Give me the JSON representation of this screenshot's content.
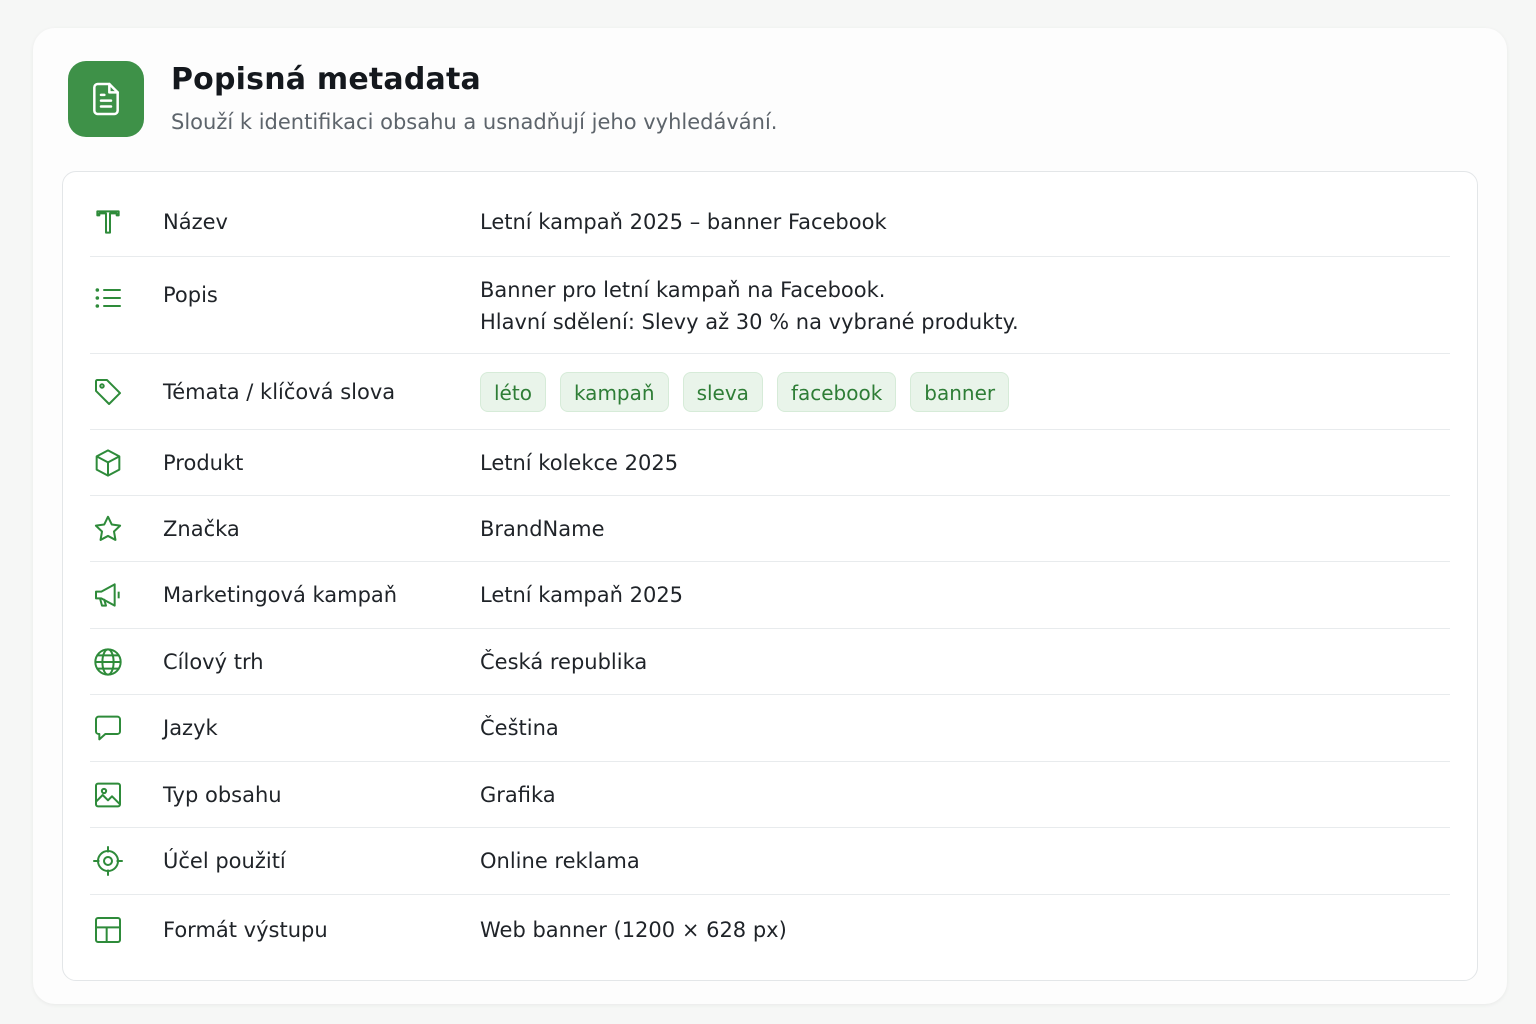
{
  "header": {
    "title": "Popisná metadata",
    "subtitle": "Slouží k identifikaci obsahu a usnadňují jeho vyhledávání.",
    "icon": "document-icon",
    "accent_color": "#3e9148"
  },
  "rows": {
    "name": {
      "icon": "text-icon",
      "label": "Název",
      "value": "Letní kampaň 2025 – banner Facebook"
    },
    "description": {
      "icon": "list-icon",
      "label": "Popis",
      "line1": "Banner pro letní kampaň na Facebook.",
      "line2": "Hlavní sdělení: Slevy až 30 % na vybrané produkty."
    },
    "keywords": {
      "icon": "tag-icon",
      "label": "Témata / klíčová slova",
      "tags": [
        "léto",
        "kampaň",
        "sleva",
        "facebook",
        "banner"
      ]
    },
    "product": {
      "icon": "box-icon",
      "label": "Produkt",
      "value": "Letní kolekce 2025"
    },
    "brand": {
      "icon": "star-icon",
      "label": "Značka",
      "value": "BrandName"
    },
    "campaign": {
      "icon": "megaphone-icon",
      "label": "Marketingová kampaň",
      "value": "Letní kampaň 2025"
    },
    "market": {
      "icon": "globe-icon",
      "label": "Cílový trh",
      "value": "Česká republika"
    },
    "language": {
      "icon": "chat-bubble-icon",
      "label": "Jazyk",
      "value": "Čeština"
    },
    "content_type": {
      "icon": "image-icon",
      "label": "Typ obsahu",
      "value": "Grafika"
    },
    "purpose": {
      "icon": "target-icon",
      "label": "Účel použití",
      "value": "Online reklama"
    },
    "output_format": {
      "icon": "layout-icon",
      "label": "Formát výstupu",
      "value": "Web banner (1200 × 628 px)"
    }
  }
}
